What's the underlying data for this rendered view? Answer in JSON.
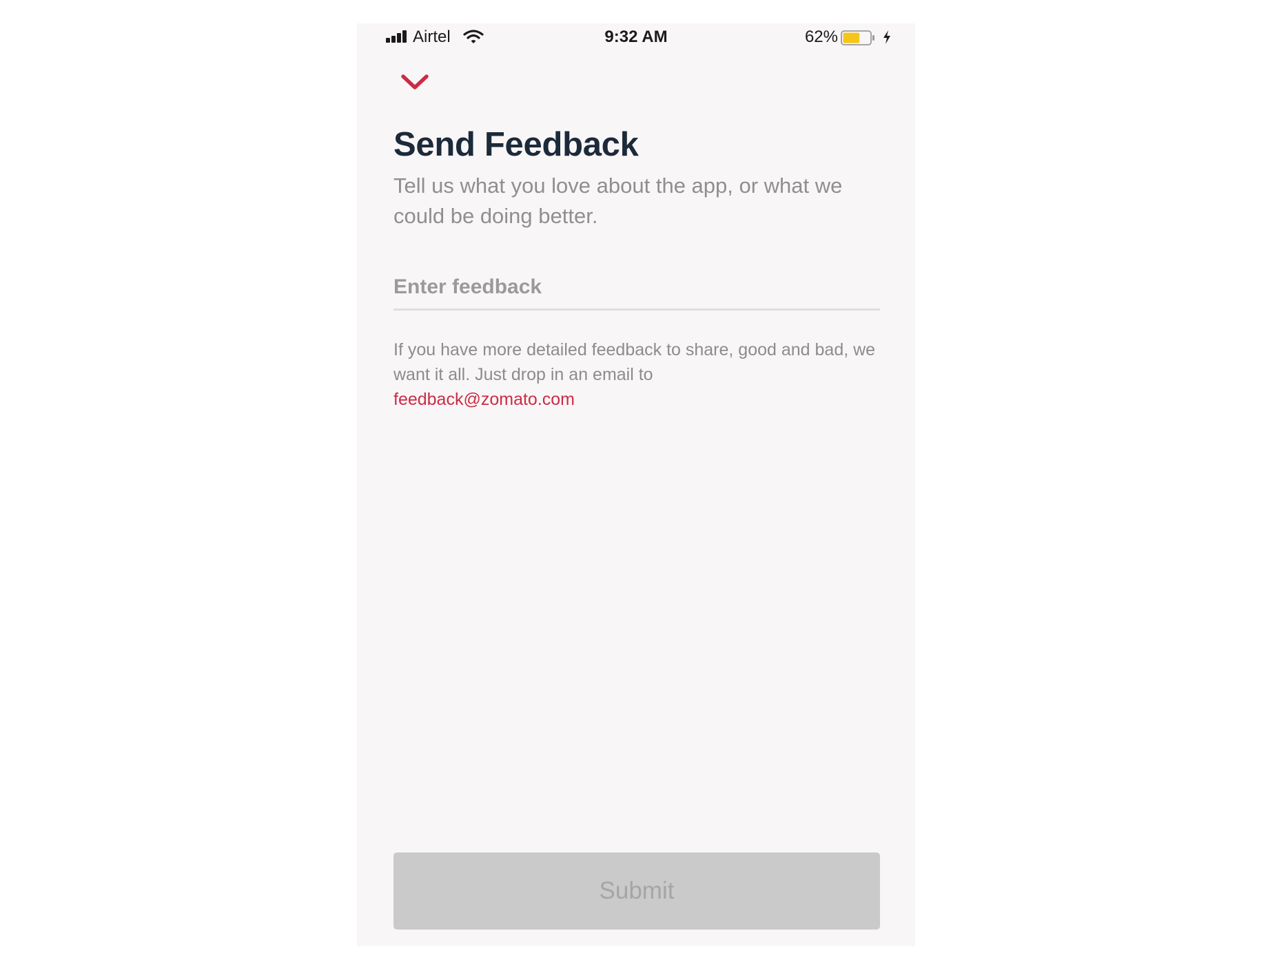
{
  "status_bar": {
    "carrier": "Airtel",
    "time": "9:32 AM",
    "battery_percent": "62%",
    "battery_level": 0.62,
    "charging": true,
    "icons": [
      "signal-icon",
      "wifi-icon",
      "battery-icon",
      "charging-bolt-icon"
    ]
  },
  "header": {
    "dismiss_icon": "chevron-down-icon",
    "title": "Send Feedback",
    "subtitle": "Tell us what you love about the app, or what we could be doing better."
  },
  "form": {
    "feedback_placeholder": "Enter feedback",
    "feedback_value": ""
  },
  "info": {
    "text": "If you have more detailed feedback to share, good and bad, we want it all. Just drop in an email to",
    "email": "feedback@zomato.com"
  },
  "actions": {
    "submit_label": "Submit"
  },
  "colors": {
    "accent": "#cb2c45",
    "title": "#1c2a3a",
    "background": "#f9f6f7",
    "button_disabled": "#cbcacb",
    "battery_fill": "#f5c518"
  }
}
